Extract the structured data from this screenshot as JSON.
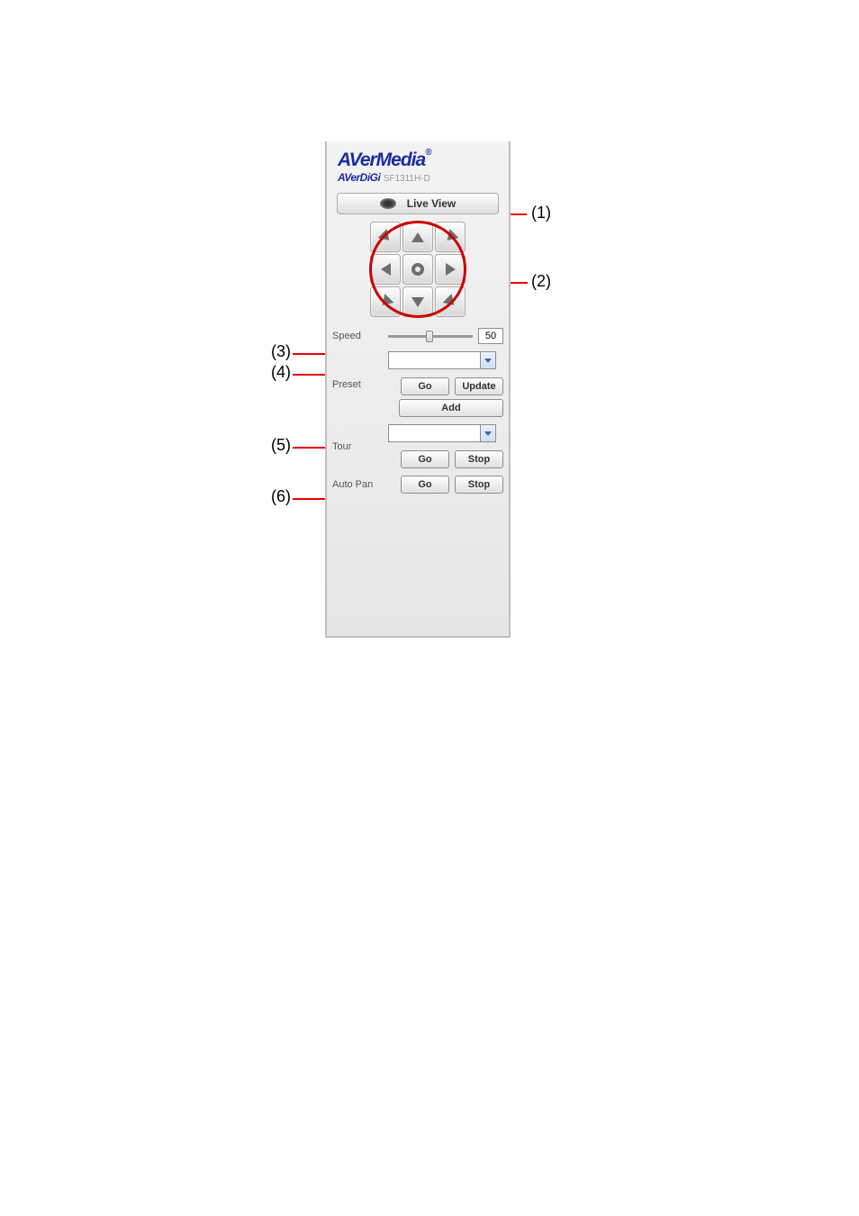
{
  "branding": {
    "title": "AVerMedia",
    "subbrand": "AVerDiGi",
    "model": "SF1311H-D"
  },
  "live_view_label": "Live View",
  "controls": {
    "speed": {
      "label": "Speed",
      "value": "50"
    },
    "preset": {
      "label": "Preset",
      "go": "Go",
      "update": "Update",
      "add": "Add"
    },
    "tour": {
      "label": "Tour",
      "go": "Go",
      "stop": "Stop"
    },
    "autopan": {
      "label": "Auto Pan",
      "go": "Go",
      "stop": "Stop"
    }
  },
  "callouts": {
    "c1": "(1)",
    "c2": "(2)",
    "c3": "(3)",
    "c4": "(4)",
    "c5": "(5)",
    "c6": "(6)"
  }
}
